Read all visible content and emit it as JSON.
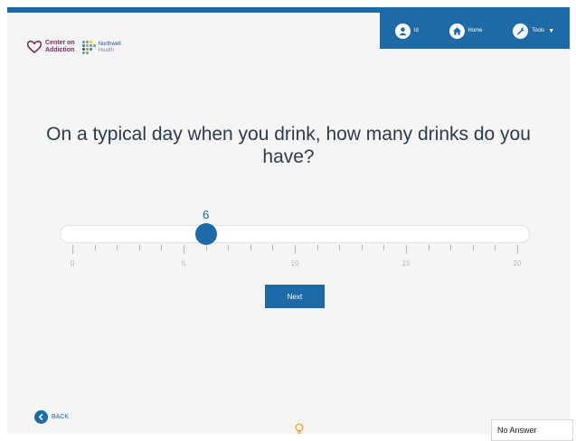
{
  "nav": {
    "user_label": "Id",
    "home_label": "Home",
    "tools_label": "Tools",
    "icons": [
      "user-icon",
      "home-icon",
      "wrench-icon",
      "caret-down-icon"
    ]
  },
  "logos": {
    "center_on_addiction": [
      "Center on",
      "Addiction"
    ],
    "northwell": [
      "Northwell",
      "Health"
    ]
  },
  "question": "On a typical day when you drink, how many drinks do you have?",
  "slider": {
    "value": "6",
    "min": 0,
    "max": 20,
    "step": 1,
    "tick_labels": [
      "0",
      "5",
      "10",
      "15",
      "20"
    ]
  },
  "next_label": "Next",
  "back_label": "BACK",
  "no_answer_label": "No Answer",
  "colors": {
    "primary": "#1e6aa6",
    "brand_purple": "#7a2a66",
    "hint_orange": "#f0a830"
  }
}
